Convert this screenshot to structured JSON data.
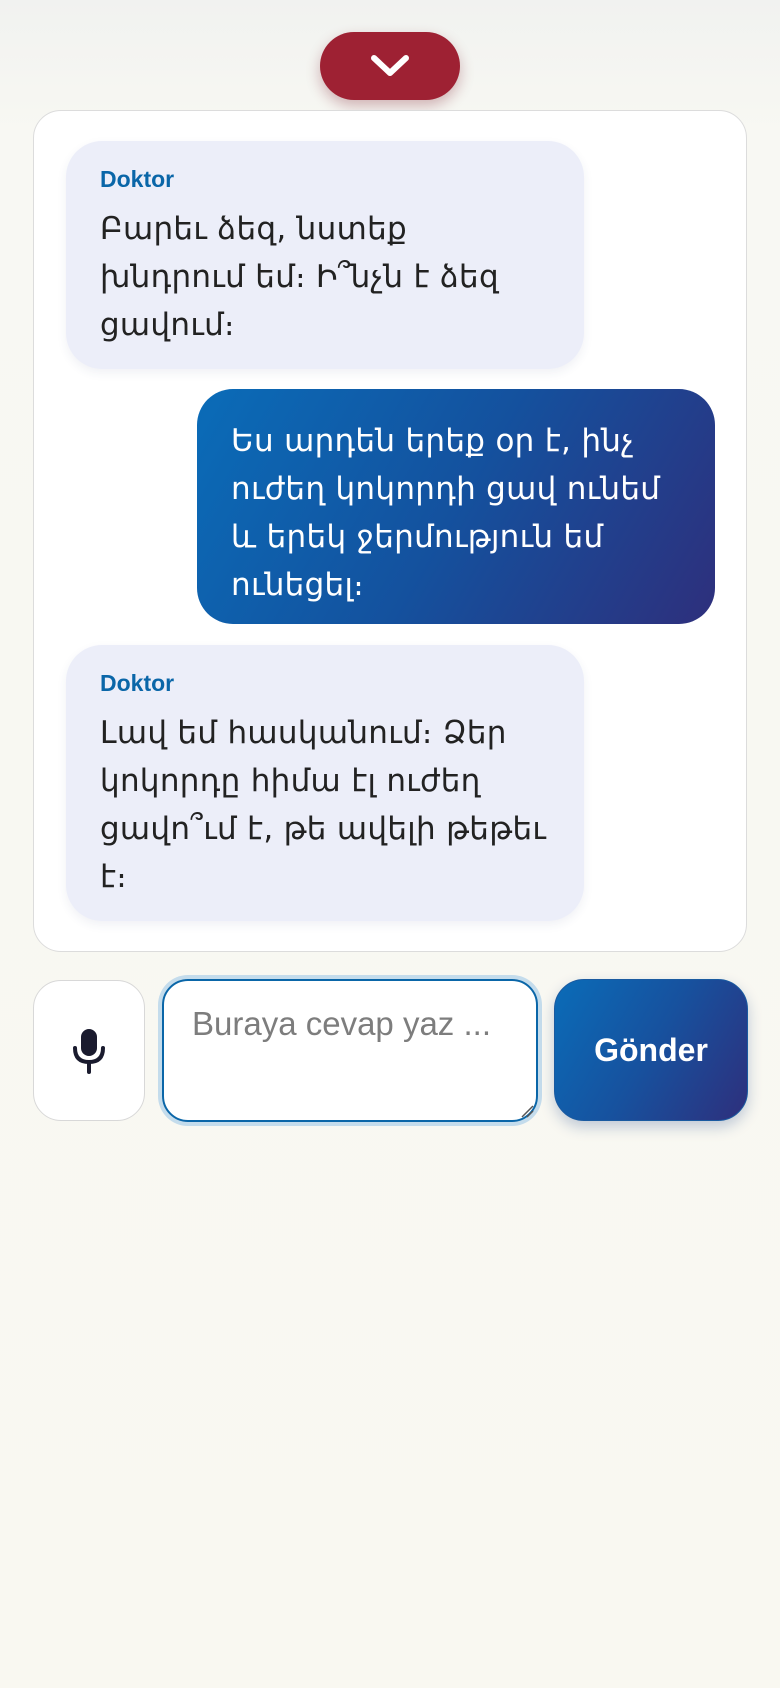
{
  "header": {
    "collapse_icon": "chevron-down-icon",
    "accent_color": "#9e2133"
  },
  "chat": {
    "messages": [
      {
        "role": "doctor",
        "sender": "Doktor",
        "text": "Բարեւ ձեզ, նստեք խնդրում եմ։ Ի՞նչն է ձեզ ցավում։"
      },
      {
        "role": "patient",
        "text": "Ես արդեն երեք օր է, ինչ ուժեղ կոկորդի ցավ ունեմ և երեկ ջերմություն եմ ունեցել։"
      },
      {
        "role": "doctor",
        "sender": "Doktor",
        "text": "Լավ եմ հասկանում։ Ձեր կոկորդը հիմա էլ ուժեղ ցավո՞ւմ է, թե ավելի թեթեւ է։"
      }
    ]
  },
  "composer": {
    "mic_icon": "microphone-icon",
    "input_value": "",
    "input_placeholder": "Buraya cevap yaz ...",
    "send_label": "Gönder"
  },
  "colors": {
    "doctor_bubble": "#eceef9",
    "sender_name": "#0a66a8",
    "patient_bubble_start": "#0a6cb8",
    "patient_bubble_end": "#2e2f7c"
  }
}
